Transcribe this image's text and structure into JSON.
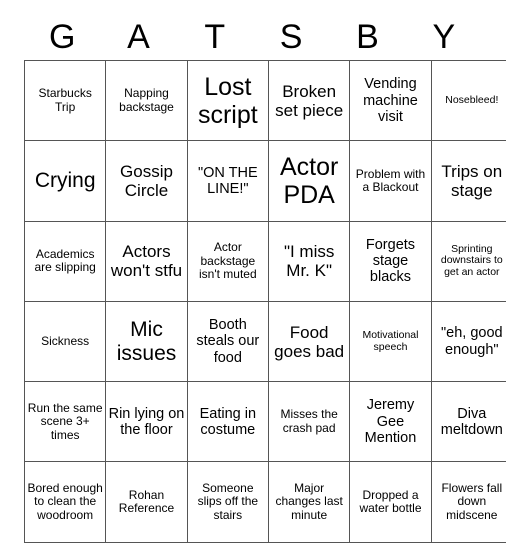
{
  "card": {
    "title_letters": [
      "G",
      "A",
      "T",
      "S",
      "B",
      "Y"
    ],
    "columns": 6,
    "rows": 6,
    "grid_line_color": "#555555",
    "background_color": "#ffffff",
    "text_color": "#000000",
    "cells": [
      [
        {
          "text": "Starbucks Trip",
          "size": "fs-s"
        },
        {
          "text": "Napping backstage",
          "size": "fs-s"
        },
        {
          "text": "Lost script",
          "size": "fs-xxl"
        },
        {
          "text": "Broken set piece",
          "size": "fs-l"
        },
        {
          "text": "Vending machine visit",
          "size": "fs-m"
        },
        {
          "text": "Nosebleed!",
          "size": "fs-xs"
        }
      ],
      [
        {
          "text": "Crying",
          "size": "fs-xl"
        },
        {
          "text": "Gossip Circle",
          "size": "fs-l"
        },
        {
          "text": "\"ON THE LINE!\"",
          "size": "fs-m"
        },
        {
          "text": "Actor PDA",
          "size": "fs-xxl"
        },
        {
          "text": "Problem with a Blackout",
          "size": "fs-s"
        },
        {
          "text": "Trips on stage",
          "size": "fs-l"
        }
      ],
      [
        {
          "text": "Academics are slipping",
          "size": "fs-s"
        },
        {
          "text": "Actors won't stfu",
          "size": "fs-l"
        },
        {
          "text": "Actor backstage isn't muted",
          "size": "fs-s"
        },
        {
          "text": "\"I miss Mr. K\"",
          "size": "fs-l"
        },
        {
          "text": "Forgets stage blacks",
          "size": "fs-m"
        },
        {
          "text": "Sprinting downstairs to get an actor",
          "size": "fs-xs"
        }
      ],
      [
        {
          "text": "Sickness",
          "size": "fs-s"
        },
        {
          "text": "Mic issues",
          "size": "fs-xl"
        },
        {
          "text": "Booth steals our food",
          "size": "fs-m"
        },
        {
          "text": "Food goes bad",
          "size": "fs-l"
        },
        {
          "text": "Motivational speech",
          "size": "fs-xs"
        },
        {
          "text": "\"eh, good enough\"",
          "size": "fs-m"
        }
      ],
      [
        {
          "text": "Run the same scene 3+ times",
          "size": "fs-s"
        },
        {
          "text": "Rin lying on the floor",
          "size": "fs-m"
        },
        {
          "text": "Eating in costume",
          "size": "fs-m"
        },
        {
          "text": "Misses the crash pad",
          "size": "fs-s"
        },
        {
          "text": "Jeremy Gee Mention",
          "size": "fs-m"
        },
        {
          "text": "Diva meltdown",
          "size": "fs-m"
        }
      ],
      [
        {
          "text": "Bored enough to clean the woodroom",
          "size": "fs-s"
        },
        {
          "text": "Rohan Reference",
          "size": "fs-s"
        },
        {
          "text": "Someone slips off the stairs",
          "size": "fs-s"
        },
        {
          "text": "Major changes last minute",
          "size": "fs-s"
        },
        {
          "text": "Dropped a water bottle",
          "size": "fs-s"
        },
        {
          "text": "Flowers fall down midscene",
          "size": "fs-s"
        }
      ]
    ]
  }
}
